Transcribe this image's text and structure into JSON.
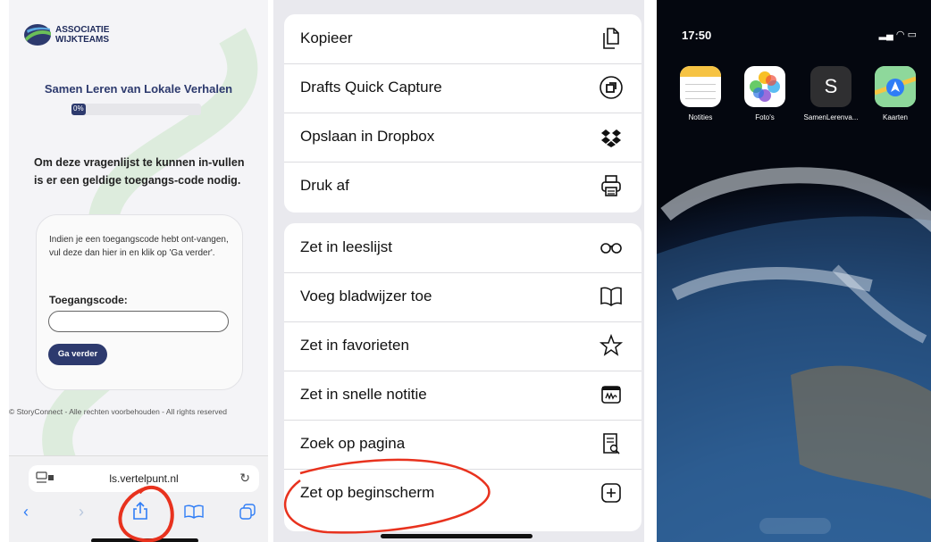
{
  "webpage": {
    "logo_line1": "ASSOCIATIE",
    "logo_line2": "WIJKTEAMS",
    "questionnaire_title": "Samen Leren van Lokale Verhalen",
    "progress_label": "0%",
    "progress_percent": 0,
    "intro_text": "Om deze vragenlijst te kunnen in-vullen is er een geldige toegangs-code nodig.",
    "card_text": "Indien je een toegangscode hebt ont-vangen, vul deze dan hier in en klik op 'Ga verder'.",
    "code_label": "Toegangscode:",
    "code_value": "",
    "go_button": "Ga verder",
    "footer": "© StoryConnect - Alle rechten voorbehouden - All rights reserved",
    "url": "ls.vertelpunt.nl",
    "colors": {
      "brand": "#2d3a6e",
      "annotation": "#e8321e",
      "link": "#2f7df6"
    }
  },
  "share_sheet": {
    "group1": [
      {
        "label": "Kopieer",
        "icon": "copy-icon"
      },
      {
        "label": "Drafts Quick Capture",
        "icon": "drafts-icon"
      },
      {
        "label": "Opslaan in Dropbox",
        "icon": "dropbox-icon"
      },
      {
        "label": "Druk af",
        "icon": "printer-icon"
      }
    ],
    "group2": [
      {
        "label": "Zet in leeslijst",
        "icon": "glasses-icon"
      },
      {
        "label": "Voeg bladwijzer toe",
        "icon": "book-icon"
      },
      {
        "label": "Zet in favorieten",
        "icon": "star-icon"
      },
      {
        "label": "Zet in snelle notitie",
        "icon": "quick-note-icon"
      },
      {
        "label": "Zoek op pagina",
        "icon": "find-in-page-icon"
      },
      {
        "label": "Zet op beginscherm",
        "icon": "add-square-icon"
      }
    ]
  },
  "home_screen": {
    "time": "17:50",
    "apps": [
      {
        "label": "Notities",
        "icon": "notes-app-icon"
      },
      {
        "label": "Foto's",
        "icon": "photos-app-icon"
      },
      {
        "label": "SamenLerenva...",
        "icon": "samen-leren-app-icon",
        "glyph": "S"
      },
      {
        "label": "Kaarten",
        "icon": "maps-app-icon"
      }
    ]
  }
}
